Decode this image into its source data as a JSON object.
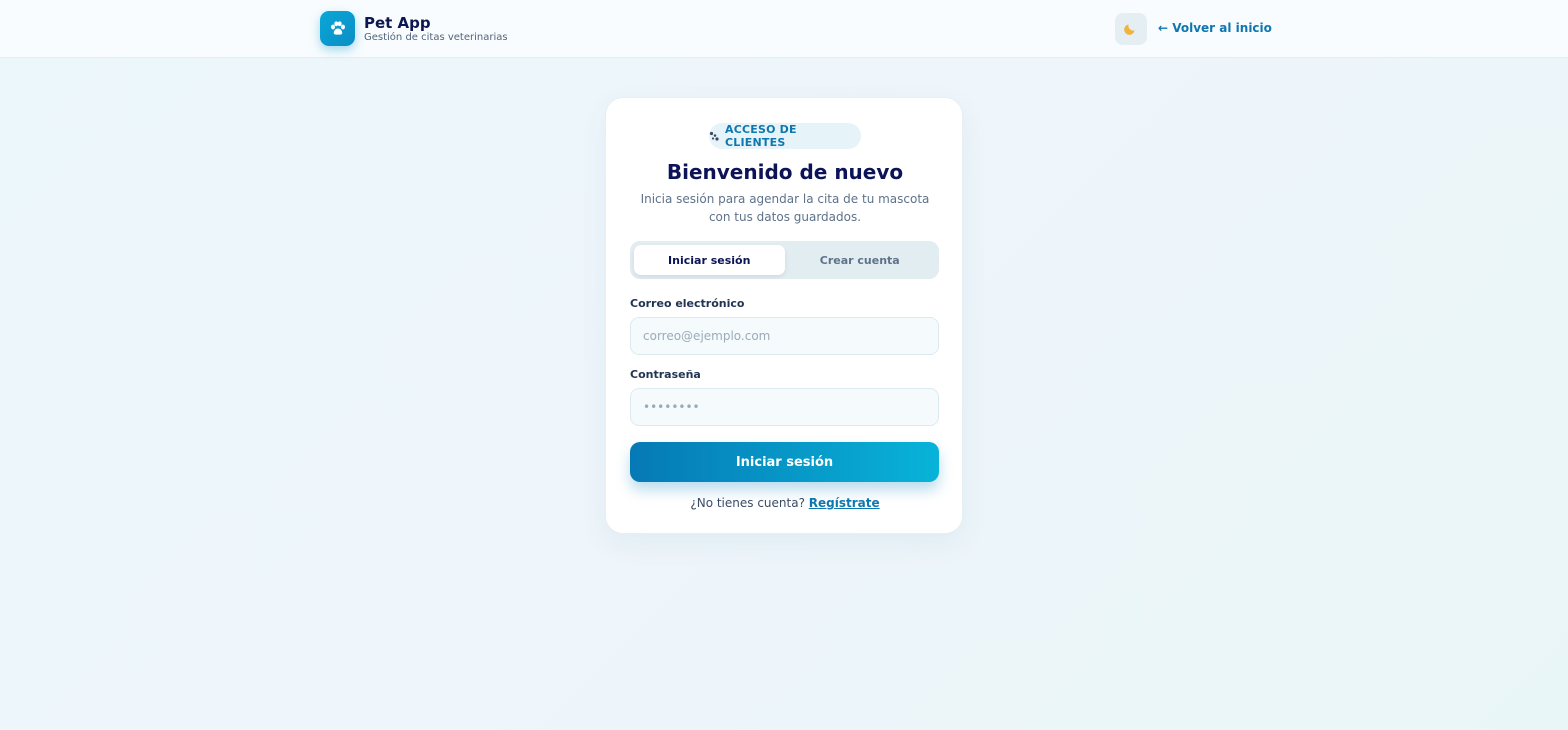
{
  "header": {
    "brand_title": "Pet App",
    "brand_subtitle": "Gestión de citas veterinarias",
    "brand_icon": "paw-icon",
    "theme_toggle_icon": "moon-icon",
    "back_link": "← Volver al inicio"
  },
  "card": {
    "badge_icon": "paw-icon",
    "badge_label": "ACCESO DE CLIENTES",
    "title": "Bienvenido de nuevo",
    "subtitle": "Inicia sesión para agendar la cita de tu mascota con tus datos guardados.",
    "tabs": [
      {
        "label": "Iniciar sesión",
        "active": true
      },
      {
        "label": "Crear cuenta",
        "active": false
      }
    ],
    "email": {
      "label": "Correo electrónico",
      "placeholder": "correo@ejemplo.com",
      "value": ""
    },
    "password": {
      "label": "Contraseña",
      "placeholder": "••••••••",
      "value": ""
    },
    "submit_label": "Iniciar sesión",
    "register_prompt": "¿No tienes cuenta?",
    "register_link": "Regístrate"
  },
  "colors": {
    "accent": "#0e77b0",
    "button_gradient_start": "#0679b5",
    "button_gradient_end": "#08b3d8",
    "title": "#0c1356"
  }
}
